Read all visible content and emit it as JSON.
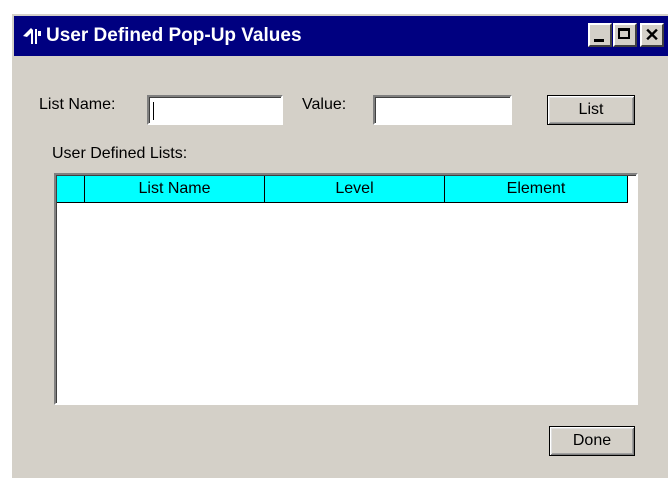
{
  "window": {
    "title": "User Defined Pop-Up Values",
    "icon": "app-icon",
    "controls": {
      "minimize": "minimize-icon",
      "maximize": "maximize-icon",
      "close": "close-icon",
      "close_glyph": "✕"
    }
  },
  "form": {
    "list_name_label": "List Name:",
    "list_name_value": "",
    "value_label": "Value:",
    "value_value": "",
    "list_button": "List"
  },
  "lists": {
    "section_label": "User Defined Lists:",
    "columns": [
      "",
      "List Name",
      "Level",
      "Element"
    ],
    "rows": []
  },
  "footer": {
    "done_button": "Done"
  },
  "colors": {
    "titlebar": "#000080",
    "header": "#00ffff",
    "face": "#d4d0c8"
  }
}
